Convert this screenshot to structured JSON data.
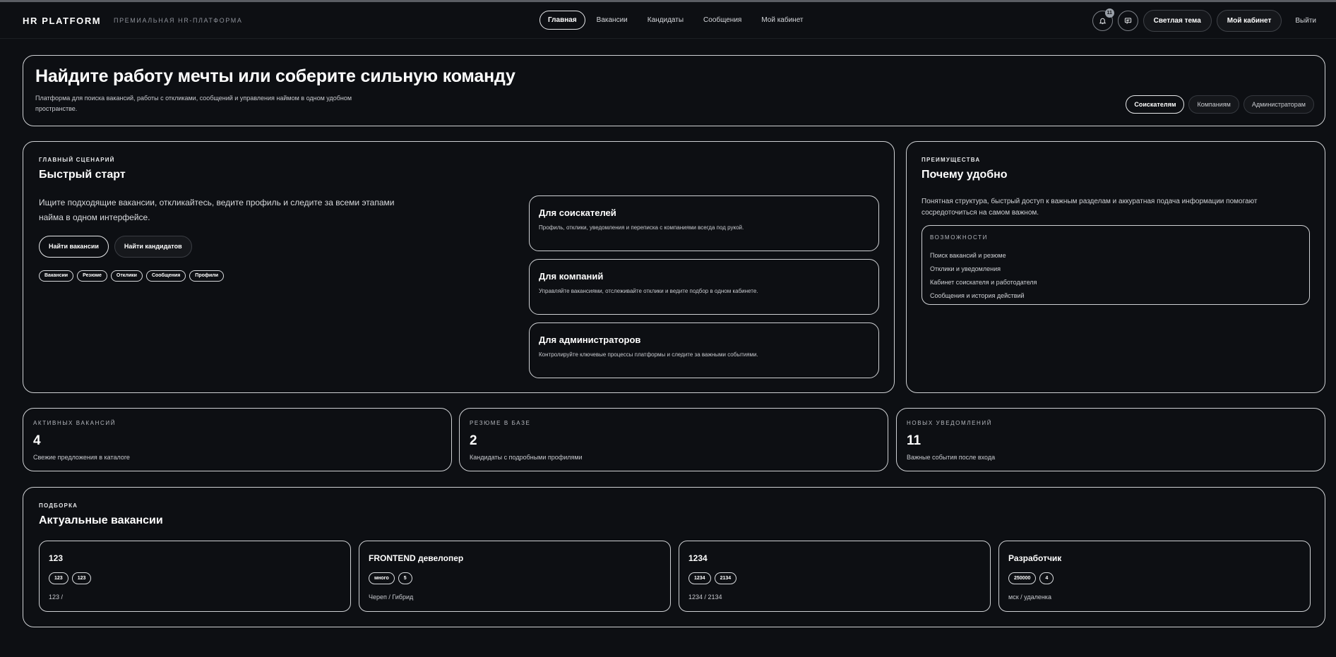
{
  "header": {
    "brand": "HR PLATFORM",
    "brand_subtitle": "ПРЕМИАЛЬНАЯ HR-ПЛАТФОРМА",
    "nav": [
      "Главная",
      "Вакансии",
      "Кандидаты",
      "Сообщения",
      "Мой кабинет"
    ],
    "active_nav": "Главная",
    "notifications_count": "11",
    "theme_button": "Светлая тема",
    "cabinet_button": "Мой кабинет",
    "logout": "Выйти"
  },
  "hero": {
    "title": "Найдите работу мечты или соберите сильную команду",
    "description": "Платформа для поиска вакансий, работы с откликами, сообщений и управления наймом в одном удобном пространстве.",
    "segments": [
      "Соискателям",
      "Компаниям",
      "Администраторам"
    ],
    "active_segment": "Соискателям"
  },
  "main": {
    "kicker": "ГЛАВНЫЙ СЦЕНАРИЙ",
    "title": "Быстрый старт",
    "description": "Ищите подходящие вакансии, откликайтесь, ведите профиль и следите за всеми этапами найма в одном интерфейсе.",
    "primary_cta": "Найти вакансии",
    "secondary_cta": "Найти кандидатов",
    "chips": [
      "Вакансии",
      "Резюме",
      "Отклики",
      "Сообщения",
      "Профили"
    ],
    "roles": [
      {
        "title": "Для соискателей",
        "description": "Профиль, отклики, уведомления и переписка с компаниями всегда под рукой."
      },
      {
        "title": "Для компаний",
        "description": "Управляйте вакансиями, отслеживайте отклики и ведите подбор в одном кабинете."
      },
      {
        "title": "Для администраторов",
        "description": "Контролируйте ключевые процессы платформы и следите за важными событиями."
      }
    ]
  },
  "advantages": {
    "kicker": "ПРЕИМУЩЕСТВА",
    "title": "Почему удобно",
    "description": "Понятная структура, быстрый доступ к важным разделам и аккуратная подача информации помогают сосредоточиться на самом важном.",
    "features_title": "ВОЗМОЖНОСТИ",
    "features": [
      "Поиск вакансий и резюме",
      "Отклики и уведомления",
      "Кабинет соискателя и работодателя",
      "Сообщения и история действий"
    ]
  },
  "stats": [
    {
      "label": "АКТИВНЫХ ВАКАНСИЙ",
      "value": "4",
      "description": "Свежие предложения в каталоге"
    },
    {
      "label": "РЕЗЮМЕ В БАЗЕ",
      "value": "2",
      "description": "Кандидаты с подробными профилями"
    },
    {
      "label": "НОВЫХ УВЕДОМЛЕНИЙ",
      "value": "11",
      "description": "Важные события после входа"
    }
  ],
  "vacancies": {
    "kicker": "ПОДБОРКА",
    "title": "Актуальные вакансии",
    "items": [
      {
        "title": "123",
        "chips": [
          "123",
          "123"
        ],
        "meta": "123 /"
      },
      {
        "title": "FRONTEND девелопер",
        "chips": [
          "много",
          "5"
        ],
        "meta": "Череп / Гибрид"
      },
      {
        "title": "1234",
        "chips": [
          "1234",
          "2134"
        ],
        "meta": "1234 / 2134"
      },
      {
        "title": "Разработчик",
        "chips": [
          "250000",
          "4"
        ],
        "meta": "мск / удаленка"
      }
    ]
  },
  "icons": {
    "notifications": "bell-icon",
    "messages": "chat-icon"
  }
}
